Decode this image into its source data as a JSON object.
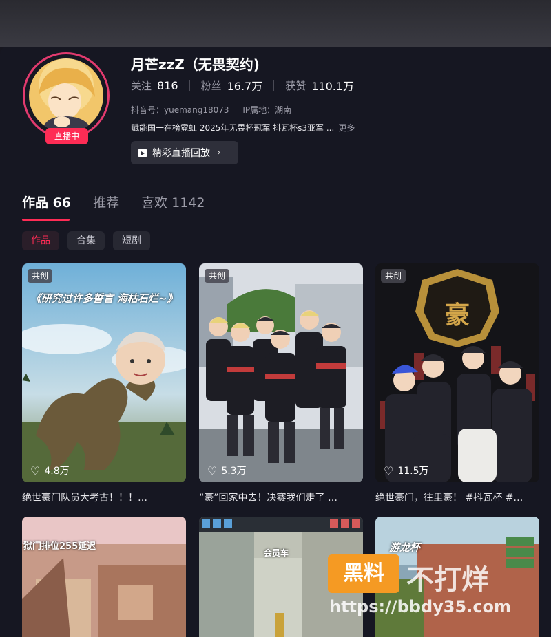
{
  "profile": {
    "name": "月芒zzZ（无畏契约)",
    "live_badge": "直播中",
    "stats": [
      {
        "label": "关注",
        "value": "816"
      },
      {
        "label": "粉丝",
        "value": "16.7万"
      },
      {
        "label": "获赞",
        "value": "110.1万"
      }
    ],
    "douyin_id": "抖音号：yuemang18073",
    "ip": "IP属地：湖南",
    "bio": "赋能国一在榜霓虹 2025年无畏杯冠军 抖瓦杯s3亚军 ...",
    "more": "更多",
    "replay_button": "精彩直播回放"
  },
  "tabs": [
    {
      "label": "作品 66"
    },
    {
      "label": "推荐"
    },
    {
      "label": "喜欢 1142"
    }
  ],
  "filters": [
    "作品",
    "合集",
    "短剧"
  ],
  "videos": [
    {
      "tag": "共创",
      "likes": "4.8万",
      "caption": "绝世豪门队员大考古！！！…",
      "overlay": "《研究过许多誓言 海枯石烂~》"
    },
    {
      "tag": "共创",
      "likes": "5.3万",
      "caption": "“豪”回家中去！决赛我们走了 …",
      "overlay": ""
    },
    {
      "tag": "共创",
      "likes": "11.5万",
      "caption": "绝世豪门，往里豪！ #抖瓦杯 #…",
      "overlay": "豪"
    },
    {
      "tag": "",
      "likes": "",
      "caption": "",
      "overlay": "狱门排位255延迟"
    },
    {
      "tag": "",
      "likes": "",
      "caption": "",
      "overlay": "会员车"
    },
    {
      "tag": "",
      "likes": "",
      "caption": "",
      "overlay": "游龙杯"
    }
  ],
  "watermark": {
    "box": "黑料",
    "text": "不打烊",
    "url": "https://bbdy35.com"
  },
  "colors": {
    "accent": "#fe2c55",
    "background": "#161722",
    "chip": "#272832"
  }
}
